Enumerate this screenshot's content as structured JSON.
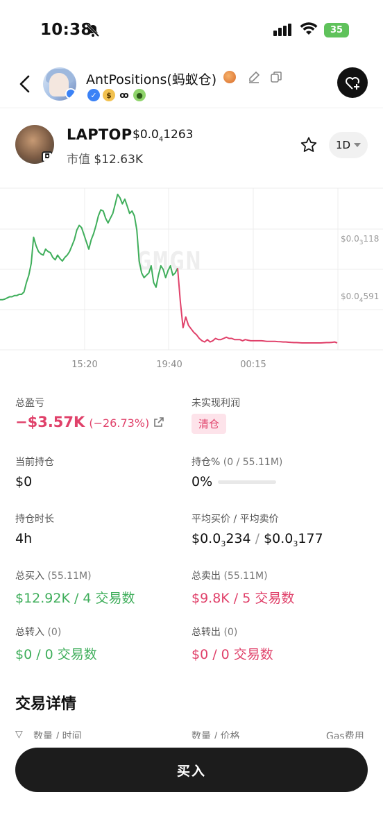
{
  "status_bar": {
    "time": "10:38",
    "battery": "35"
  },
  "header": {
    "name": "AntPositions(蚂蚁仓)"
  },
  "token": {
    "name": "LAPTOP",
    "price_prefix": "$0.0",
    "price_sub": "4",
    "price_suffix": "1263",
    "market_cap_label": "市值",
    "market_cap": "$12.63K",
    "period": "1D"
  },
  "chart_data": {
    "type": "line",
    "watermark": "GMGN",
    "y_labels": [
      {
        "prefix": "$0.0",
        "sub": "3",
        "suffix": "118"
      },
      {
        "prefix": "$0.0",
        "sub": "4",
        "suffix": "591"
      }
    ],
    "x_labels": [
      "15:20",
      "19:40",
      "00:15"
    ],
    "colors": {
      "up": "#3fae5b",
      "down": "#e0416a"
    },
    "series": [
      {
        "color": "up",
        "values": [
          0.595,
          0.595,
          0.6,
          0.61,
          0.62,
          0.62,
          0.63,
          0.63,
          0.64,
          0.64,
          0.66,
          0.74,
          0.8,
          0.9,
          1.12,
          1.05,
          1.0,
          0.98,
          0.97,
          1.02,
          1.0,
          0.99,
          0.95,
          0.93,
          0.97,
          0.94,
          0.92,
          0.95,
          0.97,
          1.0,
          1.05,
          1.1,
          1.18,
          1.22,
          1.2,
          1.14,
          1.08,
          1.02,
          1.1,
          1.15,
          1.22,
          1.3,
          1.35,
          1.34,
          1.28,
          1.24,
          1.28,
          1.32,
          1.4,
          1.48,
          1.45,
          1.4,
          1.44,
          1.38,
          1.32,
          1.34,
          1.3,
          1.18,
          0.92,
          0.82,
          0.78,
          0.8,
          0.82,
          0.88,
          0.74,
          0.7,
          0.8,
          0.88,
          0.85,
          0.78,
          0.84,
          0.88,
          0.8,
          0.82,
          0.86
        ]
      },
      {
        "color": "down",
        "values": [
          0.86,
          0.58,
          0.36,
          0.45,
          0.38,
          0.35,
          0.32,
          0.3,
          0.27,
          0.25,
          0.24,
          0.26,
          0.24,
          0.25,
          0.27,
          0.26,
          0.26,
          0.27,
          0.28,
          0.27,
          0.27,
          0.26,
          0.26,
          0.26,
          0.25,
          0.26,
          0.255,
          0.25,
          0.25,
          0.25,
          0.25,
          0.25,
          0.248,
          0.245,
          0.245,
          0.245,
          0.245,
          0.243,
          0.242,
          0.24,
          0.24,
          0.238,
          0.236,
          0.235,
          0.235,
          0.234,
          0.232,
          0.232,
          0.232,
          0.232,
          0.232,
          0.232,
          0.232,
          0.232,
          0.234,
          0.235,
          0.235,
          0.236,
          0.24,
          0.232
        ]
      }
    ]
  },
  "stats": {
    "total_pnl_label": "总盈亏",
    "total_pnl": "−$3.57K",
    "total_pnl_pct": "(−26.73%)",
    "unrealized_label": "未实现利润",
    "unrealized_tag": "清仓",
    "holding_label": "当前持仓",
    "holding_value": "$0",
    "holding_pct_label": "持仓%",
    "holding_pct_sub": "(0 / 55.11M)",
    "holding_pct_value": "0%",
    "duration_label": "持仓时长",
    "duration_value": "4h",
    "avg_label": "平均买价 / 平均卖价",
    "avg_buy_prefix": "$0.0",
    "avg_buy_sub": "3",
    "avg_buy_suffix": "234",
    "avg_sep": "/",
    "avg_sell_prefix": "$0.0",
    "avg_sell_sub": "3",
    "avg_sell_suffix": "177",
    "total_buy_label": "总买入",
    "total_buy_sub": "(55.11M)",
    "total_buy_value": "$12.92K / 4 交易数",
    "total_sell_label": "总卖出",
    "total_sell_sub": "(55.11M)",
    "total_sell_value": "$9.8K / 5 交易数",
    "transfer_in_label": "总转入",
    "transfer_in_sub": "(0)",
    "transfer_in_value": "$0 / 0 交易数",
    "transfer_out_label": "总转出",
    "transfer_out_sub": "(0)",
    "transfer_out_value": "$0 / 0 交易数"
  },
  "trade_details": {
    "title": "交易详情",
    "col1": "数量 / 时间",
    "col2": "数量 / 价格",
    "col3": "Gas费用"
  },
  "buy_button": "买入"
}
